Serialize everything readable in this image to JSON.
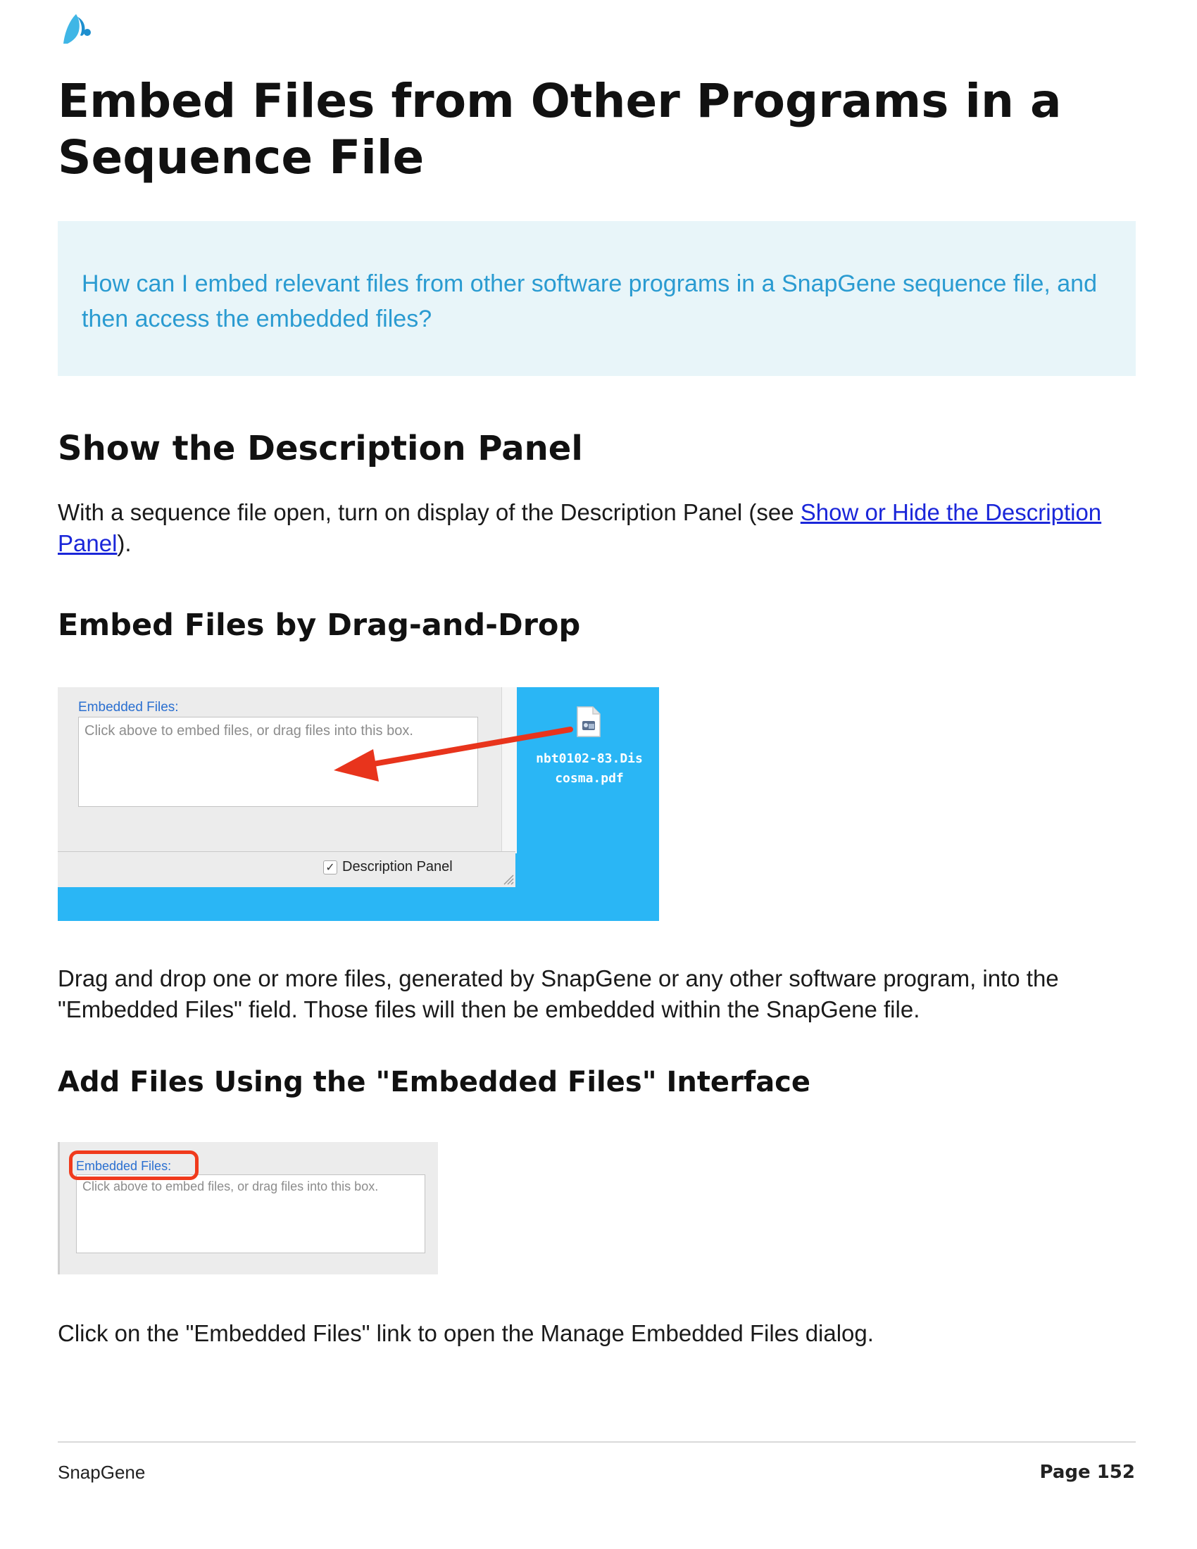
{
  "title": "Embed Files from Other Programs in a Sequence File",
  "callout": {
    "question": "How can I embed relevant files from other software programs in a SnapGene sequence file, and then access the embedded files?"
  },
  "section_description": {
    "heading": "Show the Description Panel",
    "text_before": "With a sequence file  open, turn on display of the Description Panel (see ",
    "link_text": "Show or Hide the Description Panel",
    "text_after": ")."
  },
  "section_drag": {
    "heading": "Embed Files by Drag-and-Drop",
    "screenshot": {
      "label": "Embedded Files:",
      "placeholder": "Click above to embed files, or drag files into this box.",
      "checkbox_label": "Description Panel",
      "checkbox_mark": "✓",
      "file_name": "nbt0102-83.Discosma.pdf",
      "file_name_line1": "nbt0102-83.Dis",
      "file_name_line2": "cosma.pdf",
      "arrow_color": "#e8341c",
      "desktop_color": "#2ab6f5"
    },
    "text": "Drag and drop one or more files, generated by SnapGene or any other software program, into the \"Embedded Files\" field. Those files will then be embedded within the SnapGene file."
  },
  "section_add": {
    "heading": "Add Files Using the \"Embedded Files\" Interface",
    "screenshot": {
      "label": "Embedded Files:",
      "placeholder": "Click above to embed files, or drag files into this box.",
      "highlight_color": "#f03a1c"
    },
    "text": "Click on the \"Embedded Files\" link to open the Manage Embedded Files dialog."
  },
  "footer": {
    "brand": "SnapGene",
    "page": "Page 152"
  },
  "colors": {
    "heading": "#111111",
    "callout_background": "#e8f5f9",
    "callout_text": "#2a9bd1",
    "link": "#1a26d9"
  }
}
